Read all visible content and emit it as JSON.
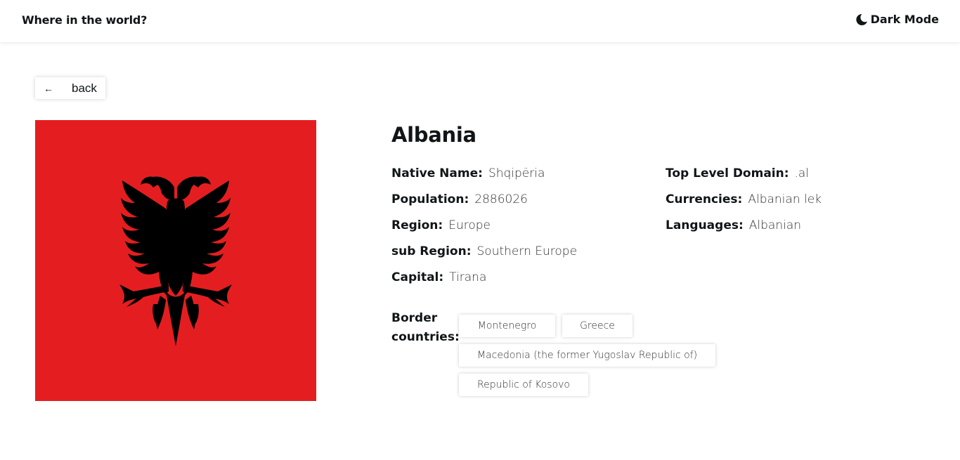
{
  "header": {
    "title": "Where in the world?",
    "mode_icon": "moon-icon",
    "mode_label": "Dark Mode"
  },
  "back": {
    "icon": "arrow-left-icon",
    "arrow": "←",
    "label": "back"
  },
  "flag": {
    "icon": "albania-flag",
    "background": "#e41e20",
    "emblem_color": "#000000"
  },
  "country": {
    "name": "Albania",
    "left": [
      {
        "label": "Native Name:",
        "value": "Shqipëria"
      },
      {
        "label": "Population:",
        "value": "2886026"
      },
      {
        "label": "Region:",
        "value": "Europe"
      },
      {
        "label": "sub Region:",
        "value": "Southern Europe"
      },
      {
        "label": "Capital:",
        "value": "Tirana"
      }
    ],
    "right": [
      {
        "label": "Top Level Domain:",
        "value": ".al"
      },
      {
        "label": "Currencies:",
        "value": "Albanian lek"
      },
      {
        "label": "Languages:",
        "value": "Albanian"
      }
    ],
    "border_label": "Border countries:",
    "border_countries": [
      "Montenegro",
      "Greece",
      "Macedonia (the former Yugoslav Republic of)",
      "Republic of Kosovo"
    ]
  }
}
